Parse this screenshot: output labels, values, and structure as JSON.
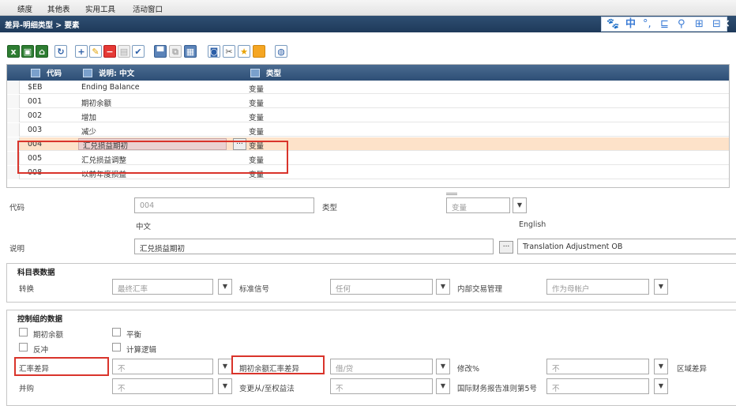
{
  "menu": {
    "items": [
      "绩度",
      "其他表",
      "实用工具",
      "活动窗口"
    ]
  },
  "window": {
    "breadcrumb": "差异-明细类型 > 要素",
    "close_label": "×"
  },
  "ime": {
    "items": [
      "🐾",
      "中",
      "°,",
      "⊑",
      "⚲",
      "⊞",
      "⊟"
    ]
  },
  "grid": {
    "columns": [
      "代码",
      "说明: 中文",
      "类型"
    ],
    "rows": [
      {
        "code": "$EB",
        "desc": "Ending Balance",
        "type": "变量"
      },
      {
        "code": "001",
        "desc": "期初余额",
        "type": "变量"
      },
      {
        "code": "002",
        "desc": "增加",
        "type": "变量"
      },
      {
        "code": "003",
        "desc": "减少",
        "type": "变量"
      },
      {
        "code": "004",
        "desc": "汇兑损益期初",
        "type": "变量"
      },
      {
        "code": "005",
        "desc": "汇兑损益调整",
        "type": "变量"
      },
      {
        "code": "008",
        "desc": "以前年度损益",
        "type": "变量"
      }
    ],
    "cell_button": "..."
  },
  "form": {
    "code_label": "代码",
    "code_value": "004",
    "type_label": "类型",
    "type_value": "变量",
    "lang_zh": "中文",
    "lang_en": "English",
    "desc_label": "说明",
    "desc_zh": "汇兑损益期初",
    "desc_en": "Translation Adjustment OB",
    "ellipsis": "..."
  },
  "chart_section": {
    "title": "科目表数据",
    "convert_label": "转换",
    "convert_value": "最终汇率",
    "sign_label": "标准信号",
    "sign_value": "任何",
    "ic_label": "内部交易管理",
    "ic_value": "作为母帐户"
  },
  "control_section": {
    "title": "控制组的数据",
    "chk_opening": "期初余额",
    "chk_balance": "平衡",
    "chk_reverse": "反冲",
    "chk_calc": "计算逻辑",
    "fx_label": "汇率差异",
    "fx_value": "不",
    "ob_fx_label": "期初余额汇率差异",
    "ob_fx_value": "借/贷",
    "modify_label": "修改%",
    "modify_value": "不",
    "region_label": "区域差异",
    "merge_label": "并购",
    "merge_value": "不",
    "change_label": "变更从/至权益法",
    "change_value": "不",
    "ifrs_label": "国际财务报告准则第5号",
    "ifrs_value": "不"
  }
}
